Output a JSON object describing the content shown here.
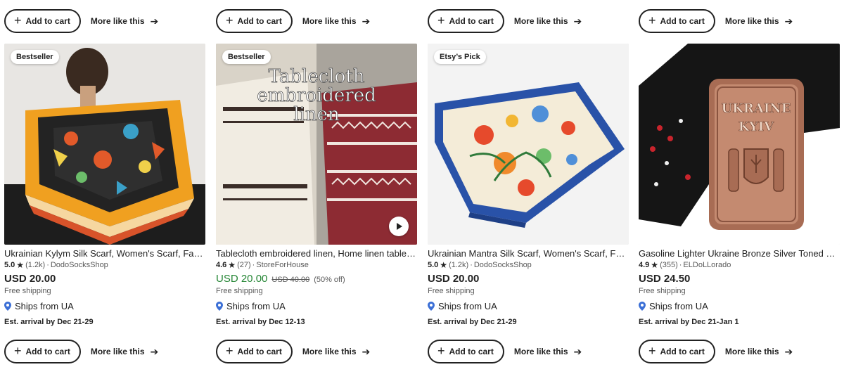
{
  "actions": {
    "add_to_cart_label": "Add to cart",
    "more_like_this_label": "More like this"
  },
  "colors": {
    "text": "#222222",
    "muted": "#595959",
    "sale_green": "#258635",
    "pin_blue": "#3b6fd6"
  },
  "listings": [
    {
      "badge": "Bestseller",
      "title": "Ukrainian Kylym Silk Scarf, Women's Scarf, Fashion Scarf",
      "rating": "5.0",
      "reviews": "(1.2k)",
      "shop": "DodoSocksShop",
      "price": "USD 20.00",
      "free_shipping": "Free shipping",
      "ships_from": "Ships from UA",
      "arrival": "Est. arrival by Dec 21-29"
    },
    {
      "badge": "Bestseller",
      "title": "Tablecloth embroidered linen, Home linen table cloth",
      "rating": "4.6",
      "reviews": "(27)",
      "shop": "StoreForHouse",
      "price": "USD 20.00",
      "original_price": "USD 40.00",
      "discount": "(50% off)",
      "free_shipping": "Free shipping",
      "ships_from": "Ships from UA",
      "arrival": "Est. arrival by Dec 12-13",
      "image_text": [
        "Tablecloth",
        "embroidered",
        "linen"
      ]
    },
    {
      "badge": "Etsy’s Pick",
      "title": "Ukrainian Mantra Silk Scarf, Women's Scarf, Fashion Scarf",
      "rating": "5.0",
      "reviews": "(1.2k)",
      "shop": "DodoSocksShop",
      "price": "USD 20.00",
      "free_shipping": "Free shipping",
      "ships_from": "Ships from UA",
      "arrival": "Est. arrival by Dec 21-29"
    },
    {
      "title": "Gasoline Lighter Ukraine Bronze Silver Toned Lighter",
      "rating": "4.9",
      "reviews": "(355)",
      "shop": "ELDoLLorado",
      "price": "USD 24.50",
      "free_shipping": "Free shipping",
      "ships_from": "Ships from UA",
      "arrival": "Est. arrival by Dec 21-Jan 1",
      "image_text": [
        "UKRAINE",
        "KYIV"
      ]
    }
  ]
}
